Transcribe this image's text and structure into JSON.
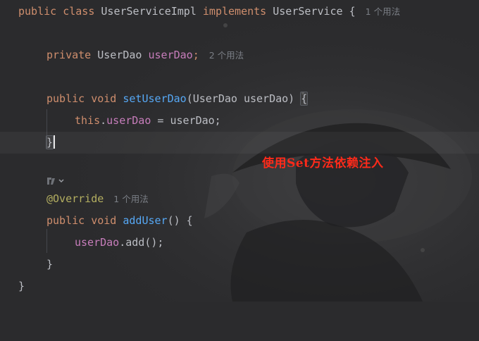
{
  "editor": {
    "line1": {
      "kw1": "public",
      "kw2": "class",
      "name": "UserServiceImpl",
      "kw3": "implements",
      "iface": "UserService",
      "brace": "{",
      "hint": "1 个用法"
    },
    "line2": {
      "kw": "private",
      "type": "UserDao",
      "field": "userDao",
      "semi": ";",
      "hint": "2 个用法"
    },
    "line3": {
      "kw1": "public",
      "kw2": "void",
      "method": "setUserDao",
      "params": "(UserDao userDao) ",
      "brace": "{"
    },
    "line4": {
      "kw": "this",
      "dot": ".",
      "field": "userDao",
      "rest": " = userDao;"
    },
    "line5": {
      "brace": "}"
    },
    "line6": {
      "annotation": "@Override",
      "hint": "1 个用法"
    },
    "line7": {
      "kw1": "public",
      "kw2": "void",
      "method": "addUser",
      "rest": "() {"
    },
    "line8": {
      "field": "userDao",
      "rest": ".add();"
    },
    "line9": {
      "brace": "}"
    },
    "line10": {
      "brace": "}"
    }
  },
  "annotation_note": "使用Set方法依赖注入",
  "colors": {
    "keyword": "#cf8e6d",
    "field": "#c77dbb",
    "method": "#56a8f5",
    "annotation": "#b3ae60",
    "note": "#ff2a1a"
  }
}
